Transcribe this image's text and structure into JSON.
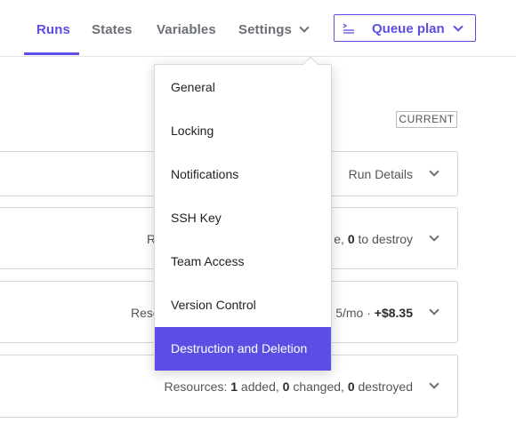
{
  "nav": {
    "tabs": [
      {
        "label": "Runs",
        "active": true
      },
      {
        "label": "States",
        "active": false
      },
      {
        "label": "Variables",
        "active": false
      },
      {
        "label": "Settings",
        "active": false
      }
    ],
    "queue_button": {
      "label": "Queue plan",
      "icon": "queue-plan-icon"
    }
  },
  "badge": "CURRENT",
  "cards": {
    "run_details": "Run Details",
    "plan_fragment_a": "R",
    "plan_fragment_b": "e, ",
    "plan_destroy_count": "0",
    "plan_destroy_label": " to destroy",
    "cost_fragment_a": "Reso",
    "cost_fragment_b": "5/mo · ",
    "cost_delta": "+$8.35",
    "apply_prefix": "Resources: ",
    "apply_added": "1",
    "apply_added_label": " added, ",
    "apply_changed": "0",
    "apply_changed_label": " changed, ",
    "apply_destroyed": "0",
    "apply_destroyed_label": " destroyed"
  },
  "settings_menu": {
    "items": [
      {
        "label": "General"
      },
      {
        "label": "Locking"
      },
      {
        "label": "Notifications"
      },
      {
        "label": "SSH Key"
      },
      {
        "label": "Team Access"
      },
      {
        "label": "Version Control"
      },
      {
        "label": "Destruction and Deletion"
      }
    ],
    "selected_index": 6
  },
  "colors": {
    "accent": "#5c4ee5",
    "muted_text": "#6b6f76",
    "border": "#d6d6d6"
  }
}
